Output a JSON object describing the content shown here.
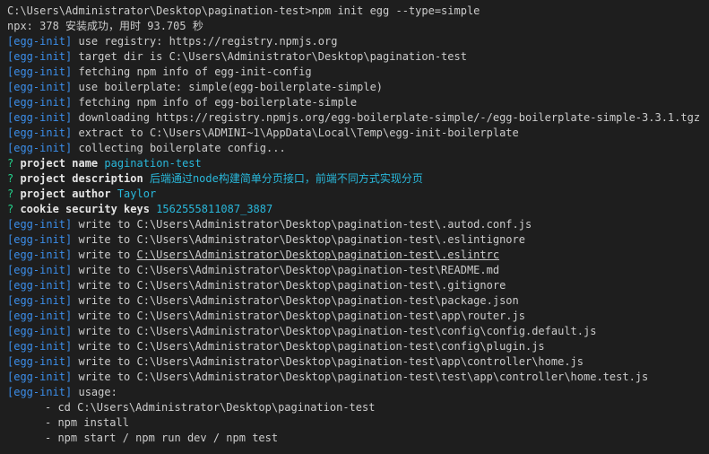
{
  "terminal": {
    "lines": [
      {
        "kind": "plain",
        "text": "C:\\Users\\Administrator\\Desktop\\pagination-test>npm init egg --type=simple"
      },
      {
        "kind": "plain",
        "text": "npx: 378 安装成功，用时 93.705 秒"
      },
      {
        "kind": "log",
        "prefix": "[egg-init]",
        "text": " use registry: https://registry.npmjs.org"
      },
      {
        "kind": "log",
        "prefix": "[egg-init]",
        "text": " target dir is C:\\Users\\Administrator\\Desktop\\pagination-test"
      },
      {
        "kind": "log",
        "prefix": "[egg-init]",
        "text": " fetching npm info of egg-init-config"
      },
      {
        "kind": "log",
        "prefix": "[egg-init]",
        "text": " use boilerplate: simple(egg-boilerplate-simple)"
      },
      {
        "kind": "log",
        "prefix": "[egg-init]",
        "text": " fetching npm info of egg-boilerplate-simple"
      },
      {
        "kind": "log",
        "prefix": "[egg-init]",
        "text": " downloading https://registry.npmjs.org/egg-boilerplate-simple/-/egg-boilerplate-simple-3.3.1.tgz"
      },
      {
        "kind": "log",
        "prefix": "[egg-init]",
        "text": " extract to C:\\Users\\ADMINI~1\\AppData\\Local\\Temp\\egg-init-boilerplate"
      },
      {
        "kind": "log",
        "prefix": "[egg-init]",
        "text": " collecting boilerplate config..."
      },
      {
        "kind": "question",
        "mark": "?",
        "label": " project name ",
        "answer": "pagination-test"
      },
      {
        "kind": "question",
        "mark": "?",
        "label": " project description ",
        "answer": "后端通过node构建简单分页接口，前端不同方式实现分页"
      },
      {
        "kind": "question",
        "mark": "?",
        "label": " project author ",
        "answer": "Taylor"
      },
      {
        "kind": "question",
        "mark": "?",
        "label": " cookie security keys ",
        "answer": "1562555811087_3887"
      },
      {
        "kind": "log",
        "prefix": "[egg-init]",
        "text": " write to C:\\Users\\Administrator\\Desktop\\pagination-test\\.autod.conf.js"
      },
      {
        "kind": "log",
        "prefix": "[egg-init]",
        "text": " write to C:\\Users\\Administrator\\Desktop\\pagination-test\\.eslintignore"
      },
      {
        "kind": "log",
        "prefix": "[egg-init]",
        "text": " write to ",
        "link": "C:\\Users\\Administrator\\Desktop\\pagination-test\\.eslintrc"
      },
      {
        "kind": "log",
        "prefix": "[egg-init]",
        "text": " write to C:\\Users\\Administrator\\Desktop\\pagination-test\\README.md"
      },
      {
        "kind": "log",
        "prefix": "[egg-init]",
        "text": " write to C:\\Users\\Administrator\\Desktop\\pagination-test\\.gitignore"
      },
      {
        "kind": "log",
        "prefix": "[egg-init]",
        "text": " write to C:\\Users\\Administrator\\Desktop\\pagination-test\\package.json"
      },
      {
        "kind": "log",
        "prefix": "[egg-init]",
        "text": " write to C:\\Users\\Administrator\\Desktop\\pagination-test\\app\\router.js"
      },
      {
        "kind": "log",
        "prefix": "[egg-init]",
        "text": " write to C:\\Users\\Administrator\\Desktop\\pagination-test\\config\\config.default.js"
      },
      {
        "kind": "log",
        "prefix": "[egg-init]",
        "text": " write to C:\\Users\\Administrator\\Desktop\\pagination-test\\config\\plugin.js"
      },
      {
        "kind": "log",
        "prefix": "[egg-init]",
        "text": " write to C:\\Users\\Administrator\\Desktop\\pagination-test\\app\\controller\\home.js"
      },
      {
        "kind": "log",
        "prefix": "[egg-init]",
        "text": " write to C:\\Users\\Administrator\\Desktop\\pagination-test\\test\\app\\controller\\home.test.js"
      },
      {
        "kind": "log",
        "prefix": "[egg-init]",
        "text": " usage:"
      },
      {
        "kind": "indent",
        "text": "- cd C:\\Users\\Administrator\\Desktop\\pagination-test"
      },
      {
        "kind": "indent",
        "text": "- npm install"
      },
      {
        "kind": "indent",
        "text": "- npm start / npm run dev / npm test"
      }
    ]
  },
  "colors": {
    "background": "#1e1e1e",
    "text": "#cccccc",
    "prefix": "#3b8eea",
    "question_mark": "#23d18b",
    "answer": "#29b8db"
  }
}
